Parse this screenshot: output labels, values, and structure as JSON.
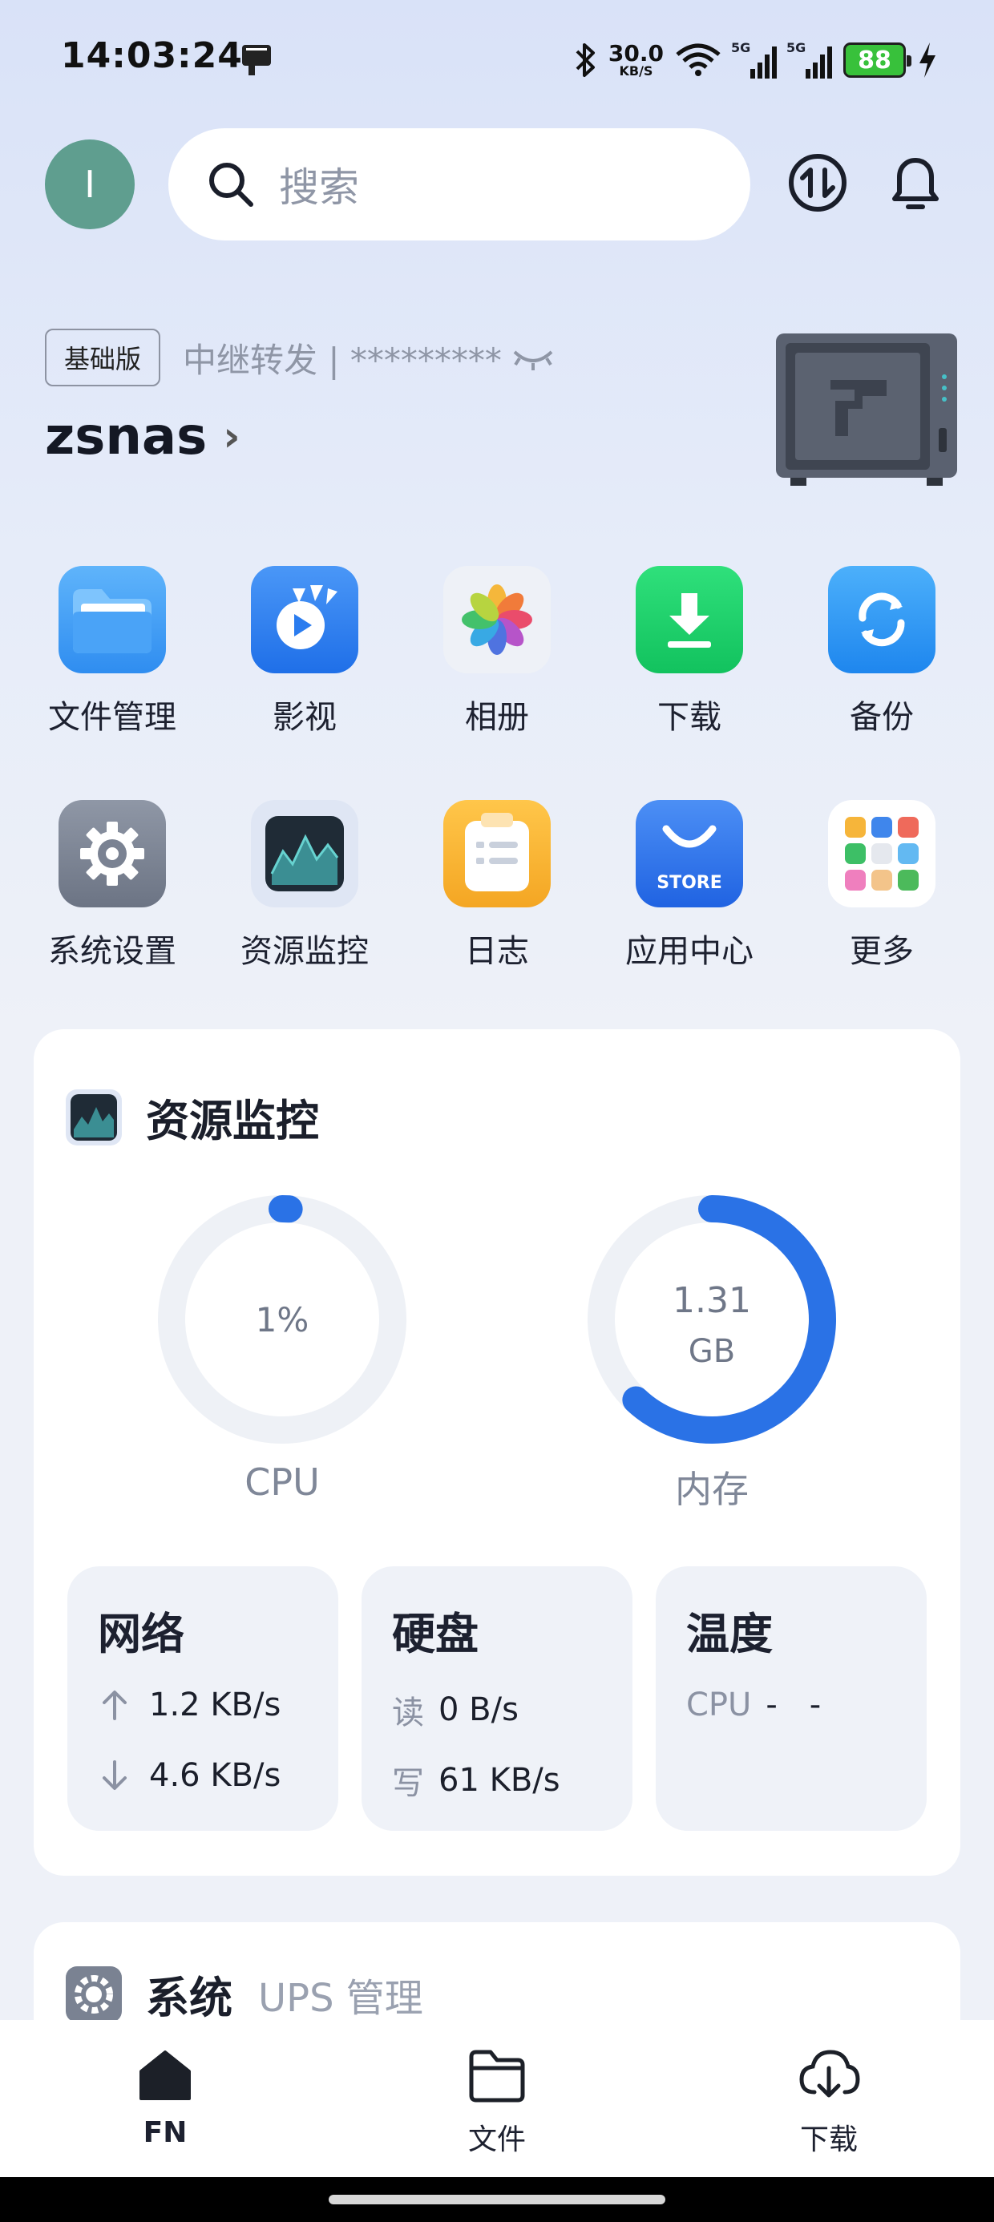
{
  "status_bar": {
    "time": "14:03:24",
    "net_speed_value": "30.0",
    "net_speed_unit": "KB/S",
    "sig1": "5G",
    "sig2": "5G",
    "battery": "88"
  },
  "header": {
    "avatar_initial": "I",
    "search_placeholder": "搜索"
  },
  "device": {
    "edition": "基础版",
    "connection": "中继转发 | *********",
    "name": "zsnas"
  },
  "apps": [
    {
      "label": "文件管理",
      "icon": "folder-icon"
    },
    {
      "label": "影视",
      "icon": "video-icon"
    },
    {
      "label": "相册",
      "icon": "photos-icon"
    },
    {
      "label": "下载",
      "icon": "download-icon"
    },
    {
      "label": "备份",
      "icon": "backup-icon"
    },
    {
      "label": "系统设置",
      "icon": "settings-icon"
    },
    {
      "label": "资源监控",
      "icon": "monitor-icon"
    },
    {
      "label": "日志",
      "icon": "log-icon"
    },
    {
      "label": "应用中心",
      "icon": "store-icon"
    },
    {
      "label": "更多",
      "icon": "more-apps-icon"
    }
  ],
  "store_icon_text": "STORE",
  "monitor": {
    "title": "资源监控",
    "cpu": {
      "label": "CPU",
      "value": "1%",
      "fraction": 0.01
    },
    "memory": {
      "label": "内存",
      "value_num": "1.31",
      "value_unit": "GB",
      "fraction": 0.62
    },
    "network": {
      "title": "网络",
      "up": "1.2 KB/s",
      "down": "4.6 KB/s"
    },
    "disk": {
      "title": "硬盘",
      "read_label": "读",
      "read": "0 B/s",
      "write_label": "写",
      "write": "61 KB/s"
    },
    "temperature": {
      "title": "温度",
      "cpu_label": "CPU",
      "cpu_value": "-",
      "cpu_value2": "-"
    }
  },
  "system": {
    "title": "系统",
    "tab_ups": "UPS 管理"
  },
  "nav": [
    {
      "label": "FN",
      "icon": "home-icon"
    },
    {
      "label": "文件",
      "icon": "folder-outline-icon"
    },
    {
      "label": "下载",
      "icon": "cloud-download-icon"
    }
  ],
  "colors": {
    "accent": "#2a72e6",
    "avatar": "#5f9e8f",
    "gauge_track": "#eef1f6"
  }
}
